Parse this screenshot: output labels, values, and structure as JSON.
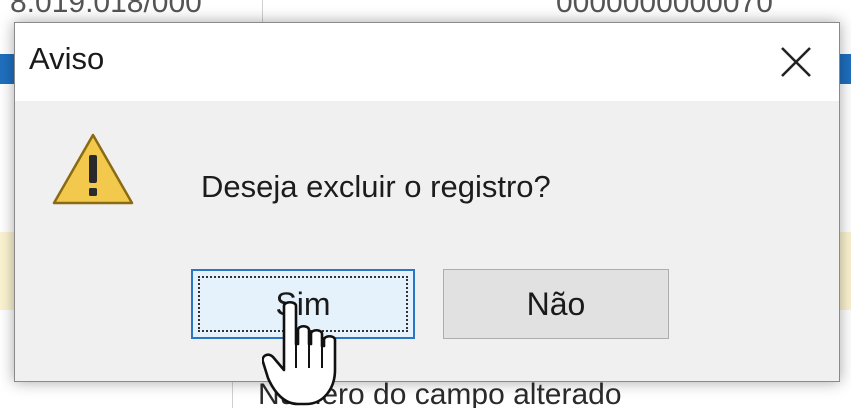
{
  "background": {
    "top_left_text": "8.019.018/000",
    "top_right_text": "0000000000070",
    "bottom_text": "Número do campo alterado"
  },
  "dialog": {
    "title": "Aviso",
    "close_icon": "close-icon",
    "warning_icon": "warning-triangle-icon",
    "message": "Deseja excluir o registro?",
    "buttons": {
      "yes_label": "Sim",
      "no_label": "Não"
    },
    "focus_color": "#2a76c6",
    "warning_color": "#f2c94c"
  },
  "cursor": {
    "icon": "hand-pointer-icon"
  }
}
